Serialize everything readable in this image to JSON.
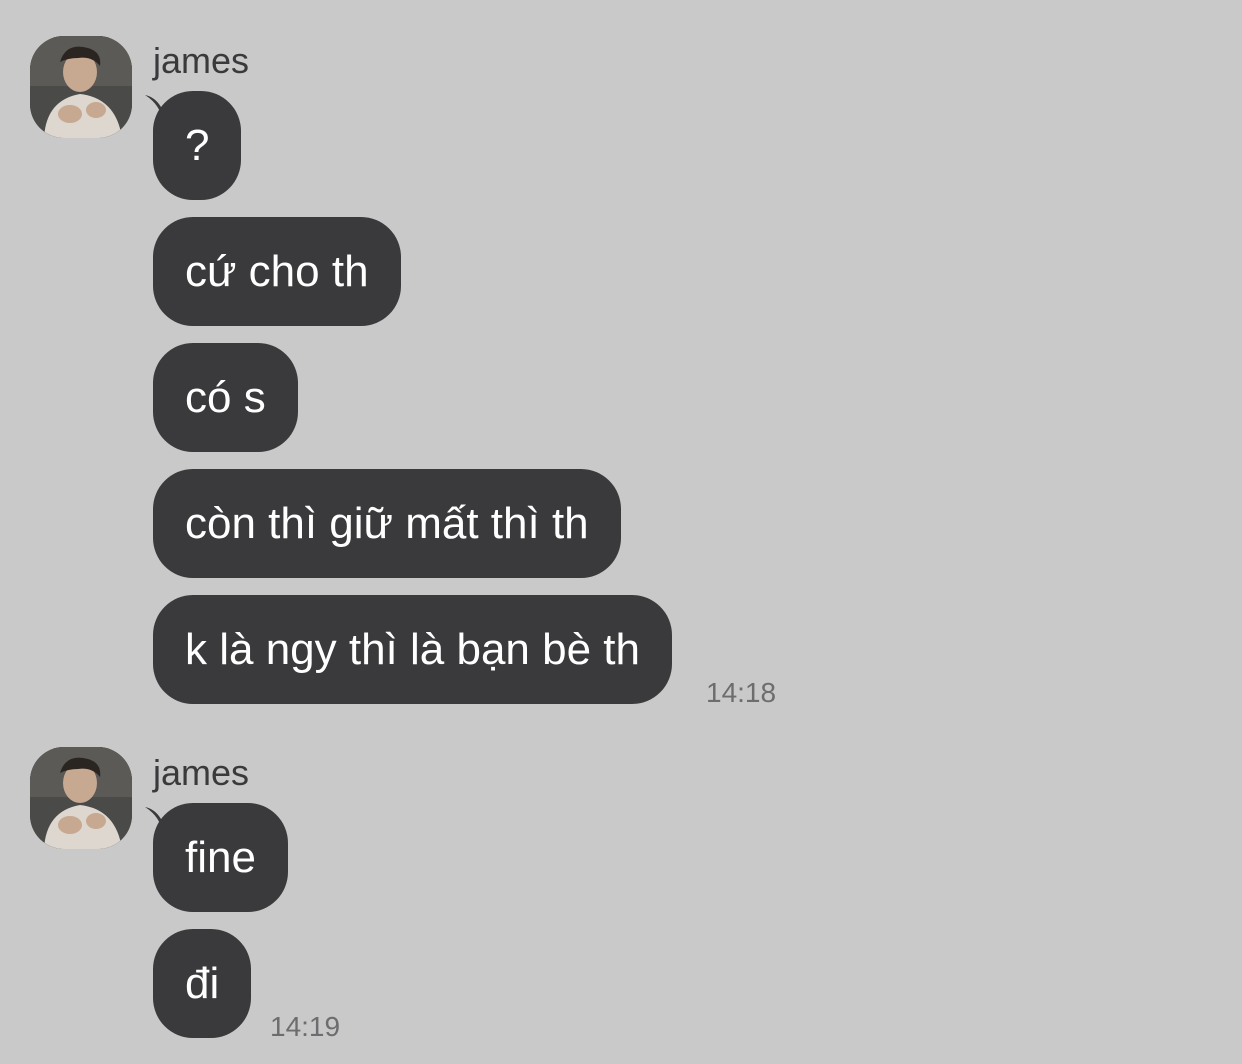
{
  "colors": {
    "background": "#c9c9c9",
    "bubble": "#3a3a3c",
    "bubble_text": "#ffffff",
    "sender_text": "#3a3a3c",
    "time_text": "#6d6d70"
  },
  "groups": [
    {
      "sender": "james",
      "avatar_icon": "user-photo-icon",
      "messages": [
        "?",
        "cứ cho th",
        "có s",
        "còn thì giữ mất thì th",
        "k là ngy thì là bạn bè th"
      ],
      "time": "14:18"
    },
    {
      "sender": "james",
      "avatar_icon": "user-photo-icon",
      "messages": [
        "fine",
        "đi"
      ],
      "time": "14:19"
    }
  ]
}
